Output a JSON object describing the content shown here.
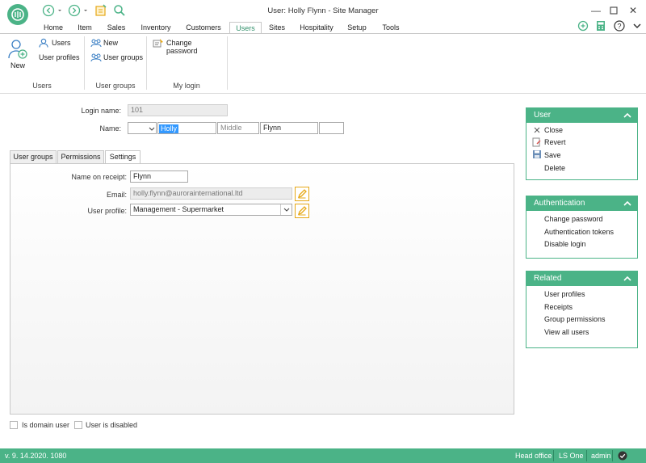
{
  "window": {
    "title": "User: Holly Flynn - Site Manager"
  },
  "menu": {
    "tabs": [
      "Home",
      "Item",
      "Sales",
      "Inventory",
      "Customers",
      "Users",
      "Sites",
      "Hospitality",
      "Setup",
      "Tools"
    ],
    "active": "Users"
  },
  "ribbon": {
    "users_group": {
      "new_label": "New",
      "users_label": "Users",
      "profiles_label": "User profiles",
      "group_label": "Users"
    },
    "usergroups_group": {
      "new_label": "New",
      "groups_label": "User groups",
      "group_label": "User groups"
    },
    "mylogin_group": {
      "change_pw_label": "Change password",
      "group_label": "My login"
    }
  },
  "form": {
    "login_name_label": "Login name:",
    "login_name_value": "101",
    "name_label": "Name:",
    "first_name": "Holly",
    "middle_placeholder": "Middle",
    "last_name": "Flynn"
  },
  "tabs": {
    "items": [
      "User groups",
      "Permissions",
      "Settings"
    ],
    "active": "Settings"
  },
  "settings": {
    "receipt_label": "Name on receipt:",
    "receipt_value": "Flynn",
    "email_label": "Email:",
    "email_value": "holly.flynn@aurorainternational.ltd",
    "profile_label": "User profile:",
    "profile_value": "Management - Supermarket"
  },
  "checkboxes": {
    "domain_user": "Is domain user",
    "disabled": "User is disabled"
  },
  "panels": {
    "user": {
      "title": "User",
      "items": [
        "Close",
        "Revert",
        "Save",
        "Delete"
      ]
    },
    "authentication": {
      "title": "Authentication",
      "items": [
        "Change password",
        "Authentication tokens",
        "Disable login"
      ]
    },
    "related": {
      "title": "Related",
      "items": [
        "User profiles",
        "Receipts",
        "Group permissions",
        "View all users"
      ]
    }
  },
  "status": {
    "version": "v. 9. 14.2020. 1080",
    "office": "Head office",
    "product": "LS One",
    "user": "admin"
  },
  "colors": {
    "accent": "#4bb387",
    "pencil": "#e6a817",
    "selection": "#3399ff"
  },
  "icons": [
    "app-logo-icon",
    "back-icon",
    "forward-icon",
    "dropdown-icon",
    "notes-icon",
    "search-icon",
    "minimize-icon",
    "maximize-icon",
    "close-icon",
    "sync-icon",
    "calculator-icon",
    "help-icon",
    "collapse-icon",
    "new-user-icon",
    "users-icon",
    "user-groups-icon",
    "change-password-icon",
    "pencil-icon",
    "chevron-up-icon",
    "revert-icon",
    "save-icon",
    "checkmark-icon"
  ]
}
